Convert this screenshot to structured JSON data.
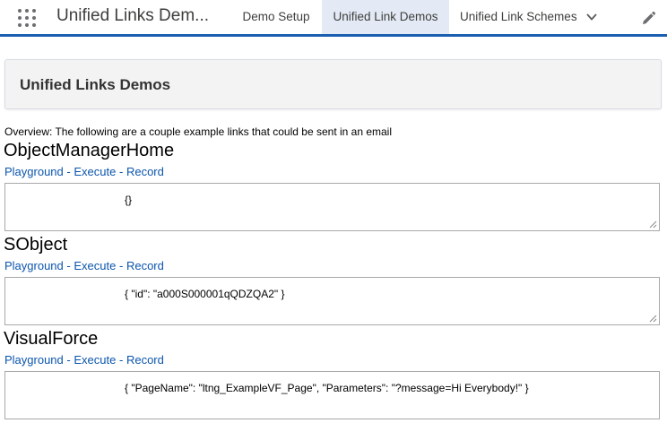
{
  "nav": {
    "app_name": "Unified Links Dem...",
    "tabs": [
      {
        "label": "Demo Setup",
        "active": false
      },
      {
        "label": "Unified Link Demos",
        "active": true
      },
      {
        "label": "Unified Link Schemes",
        "active": false
      }
    ],
    "icons": {
      "launcher": "app-launcher-icon",
      "tab_menu": "chevron-down-icon",
      "edit": "pencil-icon"
    },
    "accent_color": "#1b5fb1",
    "active_tab_bg": "#e3eaf5"
  },
  "header": {
    "title": "Unified Links Demos"
  },
  "overview": "Overview: The following are a couple example links that could be sent in an email",
  "demos": [
    {
      "name": "ObjectManagerHome",
      "links": {
        "playground": "Playground",
        "execute": "Execute",
        "record": "Record",
        "separator": "-"
      },
      "payload": "{}"
    },
    {
      "name": "SObject",
      "links": {
        "playground": "Playground",
        "execute": "Execute",
        "record": "Record",
        "separator": "-"
      },
      "payload": "{ \"id\": \"a000S000001qQDZQA2\" }"
    },
    {
      "name": "VisualForce",
      "links": {
        "playground": "Playground",
        "execute": "Execute",
        "record": "Record",
        "separator": "-"
      },
      "payload": "{ \"PageName\": \"ltng_ExampleVF_Page\", \"Parameters\": \"?message=Hi Everybody!\" }"
    }
  ],
  "link_color": "#0b55ad"
}
